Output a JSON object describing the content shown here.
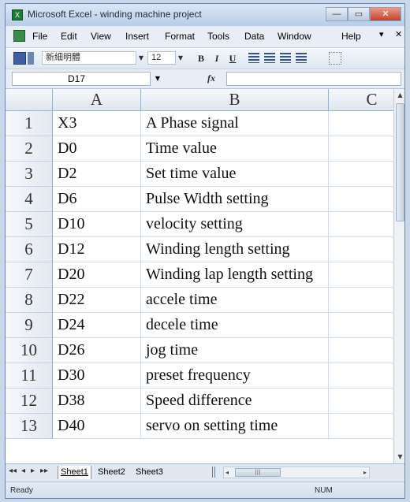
{
  "window": {
    "title": "Microsoft Excel - winding machine project",
    "minimize": "—",
    "maximize": "▭",
    "close": "✕"
  },
  "menu": {
    "items": [
      {
        "label": "File"
      },
      {
        "label": "Edit"
      },
      {
        "label": "View"
      },
      {
        "label": "Insert"
      },
      {
        "label": "Format"
      },
      {
        "label": "Tools"
      },
      {
        "label": "Data"
      },
      {
        "label": "Window"
      },
      {
        "label": "Help"
      }
    ],
    "restore": "▾",
    "close_doc": "✕"
  },
  "toolbar": {
    "font_name": "新細明體",
    "font_size": "12",
    "bold": "B",
    "italic": "I",
    "underline": "U",
    "dropdown": "▼"
  },
  "formula_bar": {
    "name_box": "D17",
    "fx": "fx",
    "value": ""
  },
  "grid": {
    "columns": [
      "A",
      "B",
      "C"
    ],
    "rows": [
      {
        "num": "1",
        "a": "X3",
        "b": "A Phase signal",
        "c": ""
      },
      {
        "num": "2",
        "a": "D0",
        "b": "Time value",
        "c": ""
      },
      {
        "num": "3",
        "a": "D2",
        "b": "Set time value",
        "c": ""
      },
      {
        "num": "4",
        "a": "D6",
        "b": "Pulse Width setting",
        "c": ""
      },
      {
        "num": "5",
        "a": "D10",
        "b": "velocity setting",
        "c": ""
      },
      {
        "num": "6",
        "a": "D12",
        "b": "Winding length setting",
        "c": ""
      },
      {
        "num": "7",
        "a": "D20",
        "b": "Winding lap length setting",
        "c": ""
      },
      {
        "num": "8",
        "a": "D22",
        "b": "accele time",
        "c": ""
      },
      {
        "num": "9",
        "a": "D24",
        "b": "decele time",
        "c": ""
      },
      {
        "num": "10",
        "a": "D26",
        "b": "jog time",
        "c": ""
      },
      {
        "num": "11",
        "a": "D30",
        "b": "preset frequency",
        "c": ""
      },
      {
        "num": "12",
        "a": "D38",
        "b": "Speed difference",
        "c": ""
      },
      {
        "num": "13",
        "a": "D40",
        "b": "servo on setting time",
        "c": ""
      }
    ]
  },
  "sheets": {
    "nav": [
      "◂◂",
      "◂",
      "▸",
      "▸▸"
    ],
    "tabs": [
      "Sheet1",
      "Sheet2",
      "Sheet3"
    ],
    "active": "Sheet1"
  },
  "scroll": {
    "up": "▲",
    "down": "▼",
    "left": "◂",
    "right": "▸",
    "grip": "|||"
  },
  "status": {
    "text": "Ready",
    "mode": "NUM"
  },
  "colors": {
    "title_gradient_top": "#dbe7f7",
    "title_gradient_bottom": "#b9cde8",
    "header_fill": "#e0e6ee",
    "close_red": "#c4412c",
    "app_icon_green": "#1f7a3a"
  }
}
